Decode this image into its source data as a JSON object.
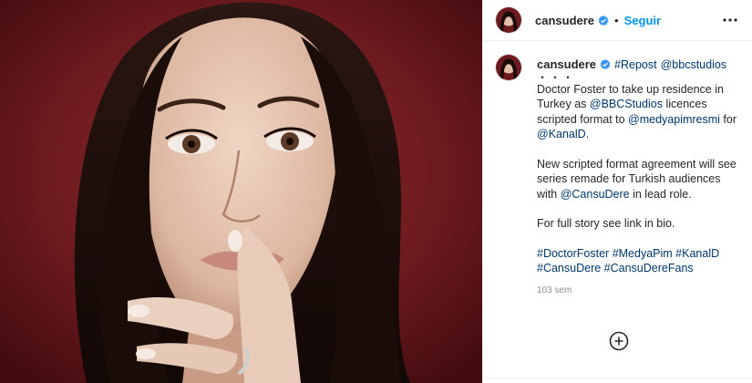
{
  "post": {
    "image_alt": "Portrait photo of a woman with finger on lips",
    "author": {
      "username": "cansudere",
      "verified": true,
      "follow_label": "Seguir",
      "dot": "•"
    },
    "caption": {
      "username": "cansudere",
      "repost_tag": "#Repost",
      "repost_mention": "@bbcstudios",
      "dots": "・・・",
      "p1": [
        {
          "text": "Doctor Foster to take up residence in Turkey as ",
          "type": "text"
        },
        {
          "text": "@BBCStudios",
          "type": "mention"
        },
        {
          "text": " licences scripted format to ",
          "type": "text"
        },
        {
          "text": "@medyapimresmi",
          "type": "mention"
        },
        {
          "text": " for ",
          "type": "text"
        },
        {
          "text": "@KanalD",
          "type": "mention"
        },
        {
          "text": ".",
          "type": "text"
        }
      ],
      "p2_a": "New scripted format agreement will see series remade for Turkish audiences with ",
      "p2_mention": "@CansuDere",
      "p2_b": " in lead role.",
      "p3": "For full story see link in bio.",
      "hashtags": [
        "#DoctorFoster",
        "#MedyaPim",
        "#KanalD",
        "#CansuDere",
        "#CansuDereFans"
      ],
      "timestamp": "103 sem"
    },
    "icons": {
      "verified": "verified-badge-icon",
      "more": "more-options-icon",
      "add": "load-more-comments-icon"
    },
    "colors": {
      "link": "#00376b",
      "follow": "#0095f6",
      "verified": "#3897f0",
      "background_photo": "#6d1b1f"
    }
  }
}
